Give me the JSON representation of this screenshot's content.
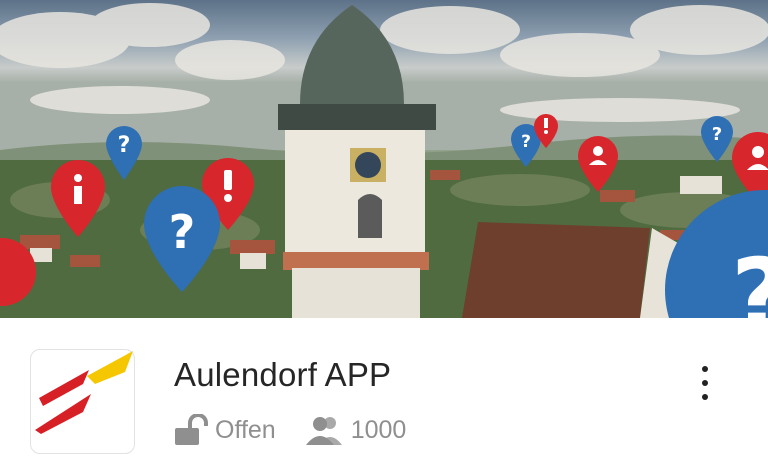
{
  "app": {
    "title": "Aulendorf APP",
    "status": "Offen",
    "member_count": "1000"
  },
  "icons": {
    "status": "lock-open-icon",
    "members": "people-icon",
    "more": "more-vertical-icon",
    "banner_pins": [
      "question-pin-icon",
      "info-pin-icon",
      "exclamation-pin-icon",
      "person-pin-icon"
    ]
  },
  "colors": {
    "pin_blue": "#2f6fb4",
    "pin_red": "#d8262d",
    "logo_red": "#d71f26",
    "logo_yellow": "#f5c700",
    "meta_gray": "#8f8f8f"
  }
}
